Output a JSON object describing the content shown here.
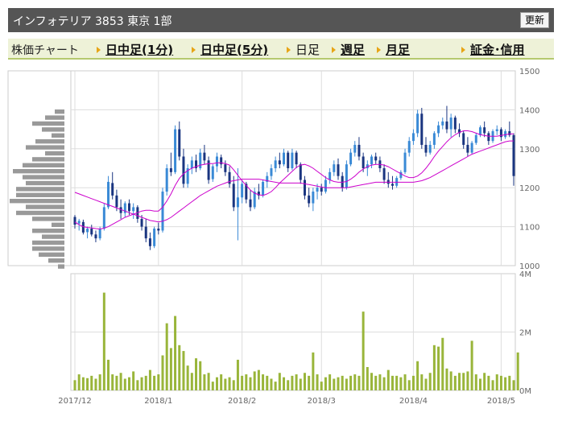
{
  "header": {
    "title": "インフォテリア  3853  東京 1部",
    "refresh_label": "更新"
  },
  "nav": {
    "label": "株価チャート",
    "items": [
      {
        "label": "日中足(1分)",
        "link": true
      },
      {
        "label": "日中足(5分)",
        "link": true
      },
      {
        "label": "日足",
        "link": false
      },
      {
        "label": "週足",
        "link": true
      },
      {
        "label": "月足",
        "link": true
      },
      {
        "label": "証金･信用",
        "link": true
      }
    ]
  },
  "colors": {
    "up": "#3a8ad6",
    "down": "#1a3580",
    "ma_short": "#cc00cc",
    "ma_long": "#cc00cc",
    "volume": "#99b53a",
    "profile": "#999999",
    "grid": "#dddddd",
    "frame": "#cccccc",
    "axis_text": "#666666"
  },
  "chart_data": {
    "type": "candlestick",
    "price_axis": {
      "ylim": [
        1000,
        1500
      ],
      "ticks": [
        "1500",
        "1400",
        "1300",
        "1200",
        "1100",
        "1000"
      ]
    },
    "volume_axis": {
      "ylim": [
        0,
        4000000
      ],
      "ticks": [
        "4M",
        "2M",
        "0M"
      ]
    },
    "x_ticks": [
      "2017/12",
      "2018/1",
      "2018/2",
      "2018/3",
      "2018/4",
      "2018/5"
    ],
    "x_tick_index": [
      0,
      20,
      40,
      59,
      81,
      102
    ],
    "candles": [
      [
        1125,
        1130,
        1095,
        1105
      ],
      [
        1108,
        1120,
        1090,
        1115
      ],
      [
        1112,
        1118,
        1080,
        1085
      ],
      [
        1086,
        1100,
        1070,
        1095
      ],
      [
        1095,
        1105,
        1075,
        1080
      ],
      [
        1080,
        1090,
        1060,
        1070
      ],
      [
        1070,
        1100,
        1065,
        1095
      ],
      [
        1095,
        1160,
        1090,
        1150
      ],
      [
        1150,
        1230,
        1145,
        1215
      ],
      [
        1212,
        1240,
        1170,
        1180
      ],
      [
        1180,
        1195,
        1140,
        1150
      ],
      [
        1150,
        1170,
        1120,
        1135
      ],
      [
        1135,
        1165,
        1125,
        1160
      ],
      [
        1160,
        1170,
        1130,
        1140
      ],
      [
        1140,
        1160,
        1120,
        1150
      ],
      [
        1150,
        1155,
        1110,
        1120
      ],
      [
        1120,
        1130,
        1090,
        1100
      ],
      [
        1100,
        1120,
        1060,
        1070
      ],
      [
        1070,
        1085,
        1040,
        1050
      ],
      [
        1050,
        1100,
        1045,
        1095
      ],
      [
        1095,
        1110,
        1080,
        1090
      ],
      [
        1090,
        1200,
        1085,
        1190
      ],
      [
        1190,
        1260,
        1180,
        1250
      ],
      [
        1250,
        1290,
        1230,
        1240
      ],
      [
        1240,
        1360,
        1235,
        1350
      ],
      [
        1350,
        1370,
        1270,
        1280
      ],
      [
        1280,
        1300,
        1200,
        1210
      ],
      [
        1210,
        1260,
        1200,
        1250
      ],
      [
        1250,
        1280,
        1235,
        1270
      ],
      [
        1270,
        1285,
        1240,
        1250
      ],
      [
        1250,
        1300,
        1245,
        1290
      ],
      [
        1290,
        1310,
        1260,
        1270
      ],
      [
        1270,
        1280,
        1210,
        1220
      ],
      [
        1222,
        1260,
        1215,
        1255
      ],
      [
        1255,
        1290,
        1240,
        1280
      ],
      [
        1278,
        1285,
        1250,
        1260
      ],
      [
        1260,
        1270,
        1230,
        1240
      ],
      [
        1240,
        1255,
        1200,
        1210
      ],
      [
        1210,
        1230,
        1140,
        1150
      ],
      [
        1150,
        1250,
        1065,
        1175
      ],
      [
        1175,
        1220,
        1160,
        1210
      ],
      [
        1210,
        1215,
        1160,
        1170
      ],
      [
        1170,
        1195,
        1140,
        1150
      ],
      [
        1150,
        1200,
        1145,
        1190
      ],
      [
        1190,
        1210,
        1170,
        1180
      ],
      [
        1180,
        1220,
        1175,
        1215
      ],
      [
        1215,
        1240,
        1200,
        1230
      ],
      [
        1230,
        1260,
        1220,
        1250
      ],
      [
        1250,
        1280,
        1240,
        1270
      ],
      [
        1270,
        1290,
        1250,
        1260
      ],
      [
        1260,
        1300,
        1255,
        1290
      ],
      [
        1290,
        1295,
        1240,
        1250
      ],
      [
        1250,
        1300,
        1245,
        1290
      ],
      [
        1290,
        1295,
        1250,
        1260
      ],
      [
        1260,
        1265,
        1210,
        1220
      ],
      [
        1220,
        1230,
        1170,
        1180
      ],
      [
        1180,
        1200,
        1150,
        1160
      ],
      [
        1160,
        1200,
        1140,
        1190
      ],
      [
        1190,
        1210,
        1170,
        1200
      ],
      [
        1200,
        1210,
        1180,
        1190
      ],
      [
        1190,
        1230,
        1185,
        1220
      ],
      [
        1220,
        1250,
        1210,
        1240
      ],
      [
        1240,
        1270,
        1230,
        1260
      ],
      [
        1260,
        1275,
        1220,
        1230
      ],
      [
        1230,
        1240,
        1190,
        1200
      ],
      [
        1200,
        1270,
        1195,
        1260
      ],
      [
        1260,
        1300,
        1255,
        1290
      ],
      [
        1290,
        1320,
        1280,
        1310
      ],
      [
        1310,
        1330,
        1270,
        1280
      ],
      [
        1280,
        1290,
        1240,
        1250
      ],
      [
        1250,
        1270,
        1230,
        1260
      ],
      [
        1260,
        1285,
        1250,
        1280
      ],
      [
        1280,
        1290,
        1260,
        1270
      ],
      [
        1270,
        1280,
        1240,
        1250
      ],
      [
        1250,
        1260,
        1210,
        1220
      ],
      [
        1220,
        1240,
        1200,
        1210
      ],
      [
        1210,
        1230,
        1195,
        1205
      ],
      [
        1205,
        1230,
        1200,
        1225
      ],
      [
        1225,
        1245,
        1220,
        1240
      ],
      [
        1240,
        1300,
        1235,
        1290
      ],
      [
        1290,
        1330,
        1280,
        1320
      ],
      [
        1320,
        1350,
        1310,
        1340
      ],
      [
        1340,
        1400,
        1330,
        1390
      ],
      [
        1390,
        1405,
        1300,
        1310
      ],
      [
        1310,
        1330,
        1280,
        1290
      ],
      [
        1290,
        1320,
        1285,
        1310
      ],
      [
        1310,
        1345,
        1300,
        1340
      ],
      [
        1340,
        1370,
        1330,
        1360
      ],
      [
        1360,
        1380,
        1350,
        1370
      ],
      [
        1370,
        1410,
        1340,
        1350
      ],
      [
        1350,
        1390,
        1330,
        1380
      ],
      [
        1380,
        1385,
        1340,
        1350
      ],
      [
        1350,
        1365,
        1330,
        1340
      ],
      [
        1340,
        1345,
        1300,
        1310
      ],
      [
        1310,
        1330,
        1280,
        1290
      ],
      [
        1290,
        1320,
        1285,
        1315
      ],
      [
        1315,
        1340,
        1310,
        1335
      ],
      [
        1335,
        1360,
        1330,
        1355
      ],
      [
        1355,
        1370,
        1330,
        1340
      ],
      [
        1340,
        1345,
        1310,
        1320
      ],
      [
        1320,
        1350,
        1315,
        1345
      ],
      [
        1345,
        1360,
        1335,
        1350
      ],
      [
        1350,
        1355,
        1320,
        1330
      ],
      [
        1330,
        1350,
        1325,
        1345
      ],
      [
        1345,
        1370,
        1330,
        1335
      ],
      [
        1335,
        1340,
        1205,
        1230
      ]
    ],
    "ma_short": [
      1112,
      1105,
      1100,
      1098,
      1097,
      1095,
      1094,
      1096,
      1100,
      1106,
      1112,
      1118,
      1124,
      1128,
      1132,
      1136,
      1140,
      1142,
      1142,
      1140,
      1140,
      1150,
      1166,
      1184,
      1206,
      1224,
      1236,
      1244,
      1250,
      1254,
      1258,
      1260,
      1262,
      1262,
      1264,
      1264,
      1262,
      1258,
      1246,
      1232,
      1218,
      1206,
      1194,
      1186,
      1182,
      1180,
      1184,
      1190,
      1200,
      1212,
      1222,
      1232,
      1242,
      1252,
      1258,
      1260,
      1256,
      1250,
      1242,
      1234,
      1226,
      1220,
      1216,
      1214,
      1214,
      1216,
      1222,
      1230,
      1240,
      1248,
      1254,
      1258,
      1260,
      1260,
      1258,
      1254,
      1248,
      1242,
      1236,
      1230,
      1226,
      1226,
      1230,
      1238,
      1250,
      1264,
      1280,
      1294,
      1306,
      1318,
      1328,
      1336,
      1342,
      1346,
      1346,
      1344,
      1340,
      1336,
      1334,
      1332,
      1332,
      1332,
      1334,
      1336,
      1338,
      1338
    ],
    "ma_long": [
      1188,
      1184,
      1180,
      1176,
      1172,
      1168,
      1164,
      1160,
      1156,
      1152,
      1148,
      1144,
      1140,
      1136,
      1132,
      1128,
      1124,
      1120,
      1116,
      1114,
      1112,
      1114,
      1118,
      1124,
      1132,
      1140,
      1148,
      1156,
      1164,
      1172,
      1180,
      1186,
      1192,
      1198,
      1204,
      1208,
      1212,
      1216,
      1218,
      1220,
      1222,
      1222,
      1222,
      1222,
      1222,
      1220,
      1218,
      1216,
      1214,
      1212,
      1212,
      1212,
      1212,
      1212,
      1212,
      1210,
      1208,
      1206,
      1204,
      1202,
      1200,
      1200,
      1200,
      1200,
      1200,
      1200,
      1202,
      1204,
      1206,
      1208,
      1210,
      1212,
      1214,
      1214,
      1214,
      1214,
      1214,
      1214,
      1214,
      1214,
      1214,
      1214,
      1216,
      1218,
      1222,
      1226,
      1232,
      1238,
      1244,
      1250,
      1256,
      1262,
      1268,
      1274,
      1280,
      1286,
      1290,
      1294,
      1298,
      1302,
      1306,
      1310,
      1314,
      1318,
      1320,
      1320
    ],
    "volume": [
      0.35,
      0.55,
      0.45,
      0.42,
      0.5,
      0.4,
      0.55,
      3.35,
      1.05,
      0.55,
      0.5,
      0.6,
      0.4,
      0.45,
      0.65,
      0.35,
      0.45,
      0.5,
      0.7,
      0.5,
      0.55,
      1.2,
      2.3,
      1.45,
      2.55,
      1.55,
      1.35,
      0.85,
      0.6,
      1.1,
      1.0,
      0.55,
      0.6,
      0.3,
      0.45,
      0.55,
      0.4,
      0.45,
      0.35,
      1.05,
      0.5,
      0.55,
      0.45,
      0.65,
      0.7,
      0.55,
      0.5,
      0.4,
      0.3,
      0.6,
      0.45,
      0.35,
      0.5,
      0.55,
      0.4,
      0.6,
      0.5,
      1.3,
      0.55,
      0.3,
      0.45,
      0.55,
      0.4,
      0.45,
      0.5,
      0.4,
      0.5,
      0.55,
      0.5,
      2.7,
      0.8,
      0.6,
      0.5,
      0.55,
      0.45,
      0.7,
      0.5,
      0.5,
      0.45,
      0.55,
      0.35,
      0.5,
      1.0,
      0.55,
      0.4,
      0.6,
      1.55,
      1.5,
      1.8,
      0.75,
      0.65,
      0.5,
      0.6,
      0.6,
      0.65,
      1.7,
      0.55,
      0.4,
      0.6,
      0.5,
      0.35,
      0.55,
      0.5,
      0.45,
      0.5,
      0.35,
      1.3
    ],
    "price_profile": [
      0.3,
      0.6,
      1.0,
      0.7,
      0.4,
      0.9,
      1.2,
      0.6,
      1.0,
      1.3,
      1.6,
      1.3,
      1.2,
      1.5,
      1.5,
      1.7,
      1.2,
      1.5,
      1.0,
      0.4,
      1.0,
      0.7,
      1.0,
      1.0,
      0.8,
      0.5,
      0.2
    ]
  }
}
